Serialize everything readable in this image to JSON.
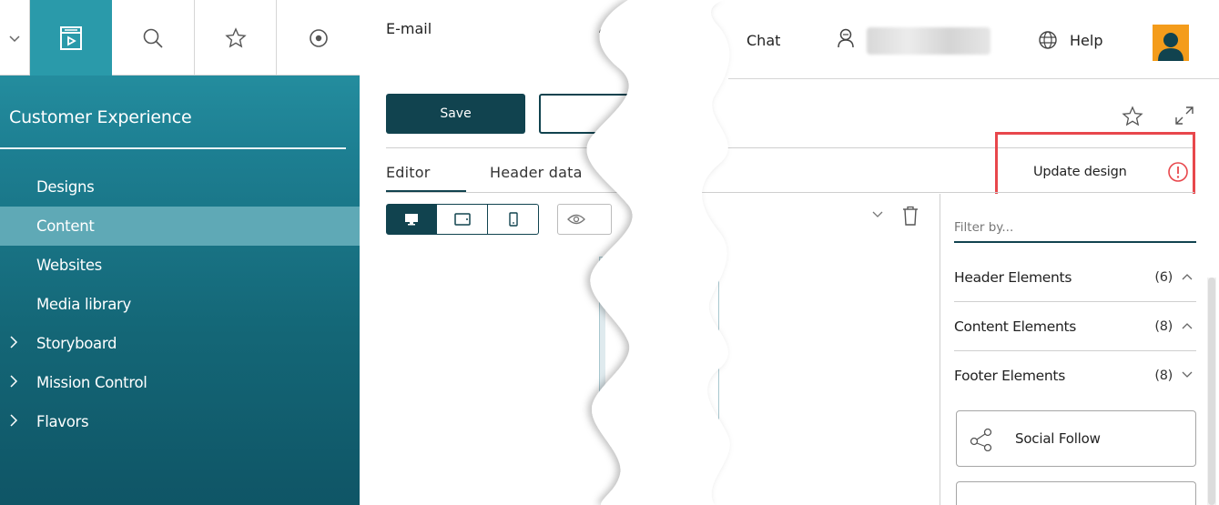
{
  "sidebar": {
    "title": "Customer Experience",
    "icons": [
      "chevron-down-icon",
      "content-icon",
      "search-icon",
      "star-icon",
      "target-icon"
    ],
    "items": [
      {
        "label": "Designs",
        "expandable": false,
        "selected": false
      },
      {
        "label": "Content",
        "expandable": false,
        "selected": true
      },
      {
        "label": "Websites",
        "expandable": false,
        "selected": false
      },
      {
        "label": "Media library",
        "expandable": false,
        "selected": false
      },
      {
        "label": "Storyboard",
        "expandable": true,
        "selected": false
      },
      {
        "label": "Mission Control",
        "expandable": true,
        "selected": false
      },
      {
        "label": "Flavors",
        "expandable": true,
        "selected": false
      }
    ]
  },
  "editor": {
    "title": "E-mail",
    "save_label": "Save",
    "tabs": [
      {
        "label": "Editor",
        "active": true
      },
      {
        "label": "Header data",
        "active": false
      }
    ]
  },
  "topbar": {
    "chat_label": "Chat",
    "help_label": "Help"
  },
  "toolbar": {
    "update_design_label": "Update design"
  },
  "elements_panel": {
    "filter_placeholder": "Filter by...",
    "categories": [
      {
        "label": "Header Elements",
        "count": "(6)",
        "expanded": true
      },
      {
        "label": "Content Elements",
        "count": "(8)",
        "expanded": true
      },
      {
        "label": "Footer Elements",
        "count": "(8)",
        "expanded": false
      }
    ],
    "cards": [
      {
        "label": "Social Follow",
        "icon": "share-icon"
      }
    ]
  },
  "colors": {
    "brand_dark": "#11434f",
    "sidebar_teal": "#1d7f92",
    "highlight": "#e8474c",
    "avatar": "#f49c1b"
  }
}
